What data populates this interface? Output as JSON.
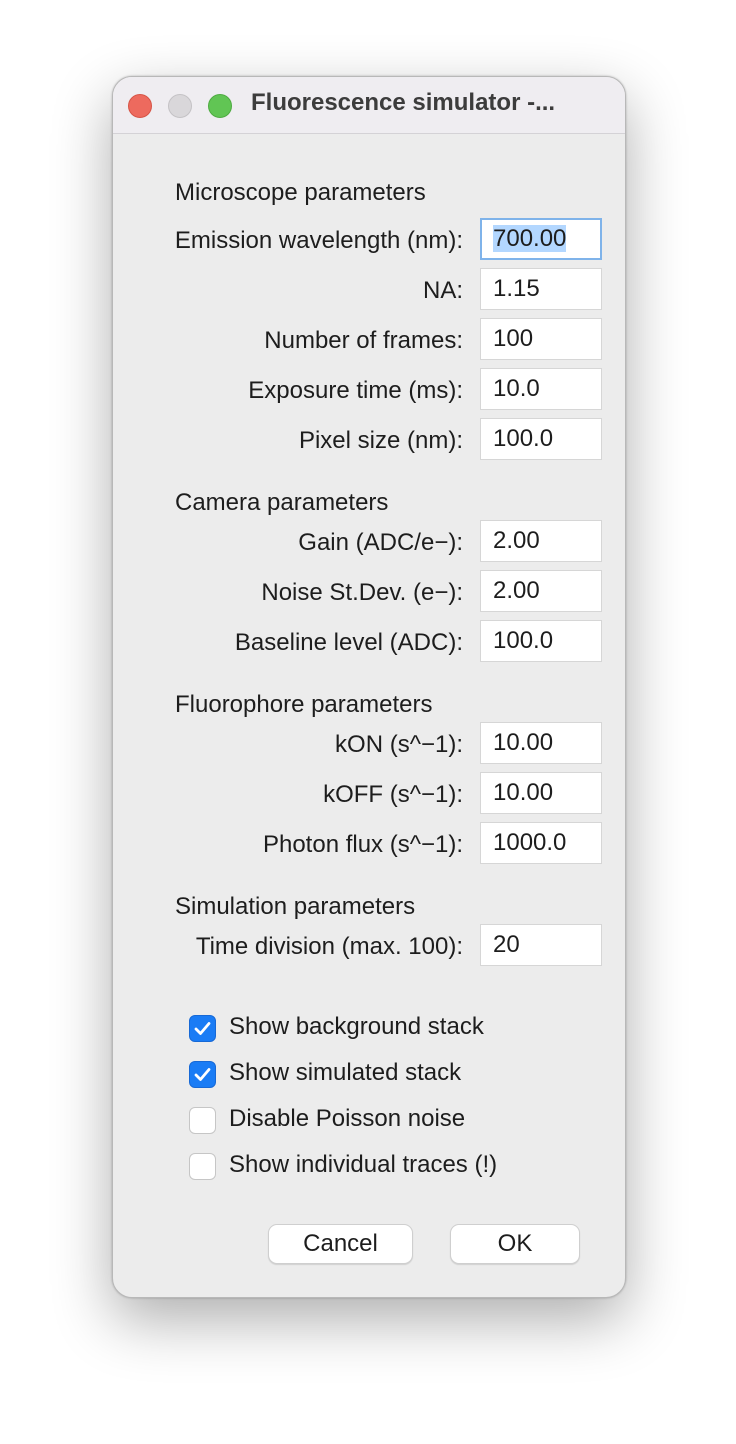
{
  "window": {
    "title": "Fluorescence simulator -..."
  },
  "microscope": {
    "heading": "Microscope parameters",
    "emission_label": "Emission wavelength (nm):",
    "emission_value": "700.00",
    "na_label": "NA:",
    "na_value": "1.15",
    "frames_label": "Number of frames:",
    "frames_value": "100",
    "exposure_label": "Exposure time (ms):",
    "exposure_value": "10.0",
    "pixel_label": "Pixel size (nm):",
    "pixel_value": "100.0"
  },
  "camera": {
    "heading": "Camera parameters",
    "gain_label": "Gain (ADC/e−):",
    "gain_value": "2.00",
    "noise_label": "Noise St.Dev. (e−):",
    "noise_value": "2.00",
    "baseline_label": "Baseline level (ADC):",
    "baseline_value": "100.0"
  },
  "fluorophore": {
    "heading": "Fluorophore parameters",
    "kon_label": "kON (s^−1):",
    "kon_value": "10.00",
    "koff_label": "kOFF (s^−1):",
    "koff_value": "10.00",
    "flux_label": "Photon flux (s^−1):",
    "flux_value": "1000.0"
  },
  "simulation": {
    "heading": "Simulation parameters",
    "time_label": "Time division (max. 100):",
    "time_value": "20"
  },
  "options": {
    "show_background_label": "Show background stack",
    "show_background_checked": true,
    "show_simulated_label": "Show simulated stack",
    "show_simulated_checked": true,
    "disable_poisson_label": "Disable Poisson noise",
    "disable_poisson_checked": false,
    "show_traces_label": "Show individual traces (!)",
    "show_traces_checked": false
  },
  "buttons": {
    "cancel": "Cancel",
    "ok": "OK"
  },
  "colors": {
    "accent": "#1a7cf5",
    "close": "#ed6a5e",
    "maximize": "#61c554"
  }
}
